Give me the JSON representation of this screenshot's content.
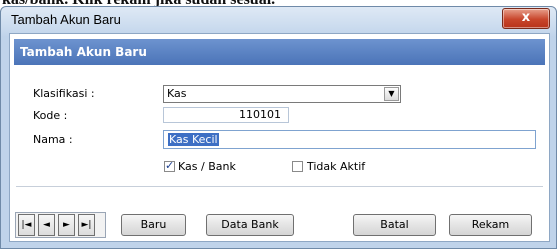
{
  "background_text": "kas/bank. Klik rekam jika sudah sesuai.",
  "window": {
    "title": "Tambah Akun Baru",
    "close_label": "x"
  },
  "panel": {
    "heading": "Tambah Akun Baru"
  },
  "form": {
    "klasifikasi_label": "Klasifikasi :",
    "klasifikasi_value": "Kas",
    "kode_label": "Kode :",
    "kode_value": "110101",
    "nama_label": "Nama :",
    "nama_value": "Kas Kecil",
    "kas_bank_label": "Kas / Bank",
    "kas_bank_checked": true,
    "tidak_aktif_label": "Tidak Aktif",
    "tidak_aktif_checked": false
  },
  "navigation": {
    "first": "|◄",
    "prev": "◄",
    "next": "►",
    "last": "►|"
  },
  "buttons": {
    "baru": "Baru",
    "data_bank": "Data Bank",
    "batal": "Batal",
    "rekam": "Rekam"
  },
  "colors": {
    "banner": "#4b74b8",
    "close_button": "#c8452b",
    "selection": "#3d6fc4"
  }
}
